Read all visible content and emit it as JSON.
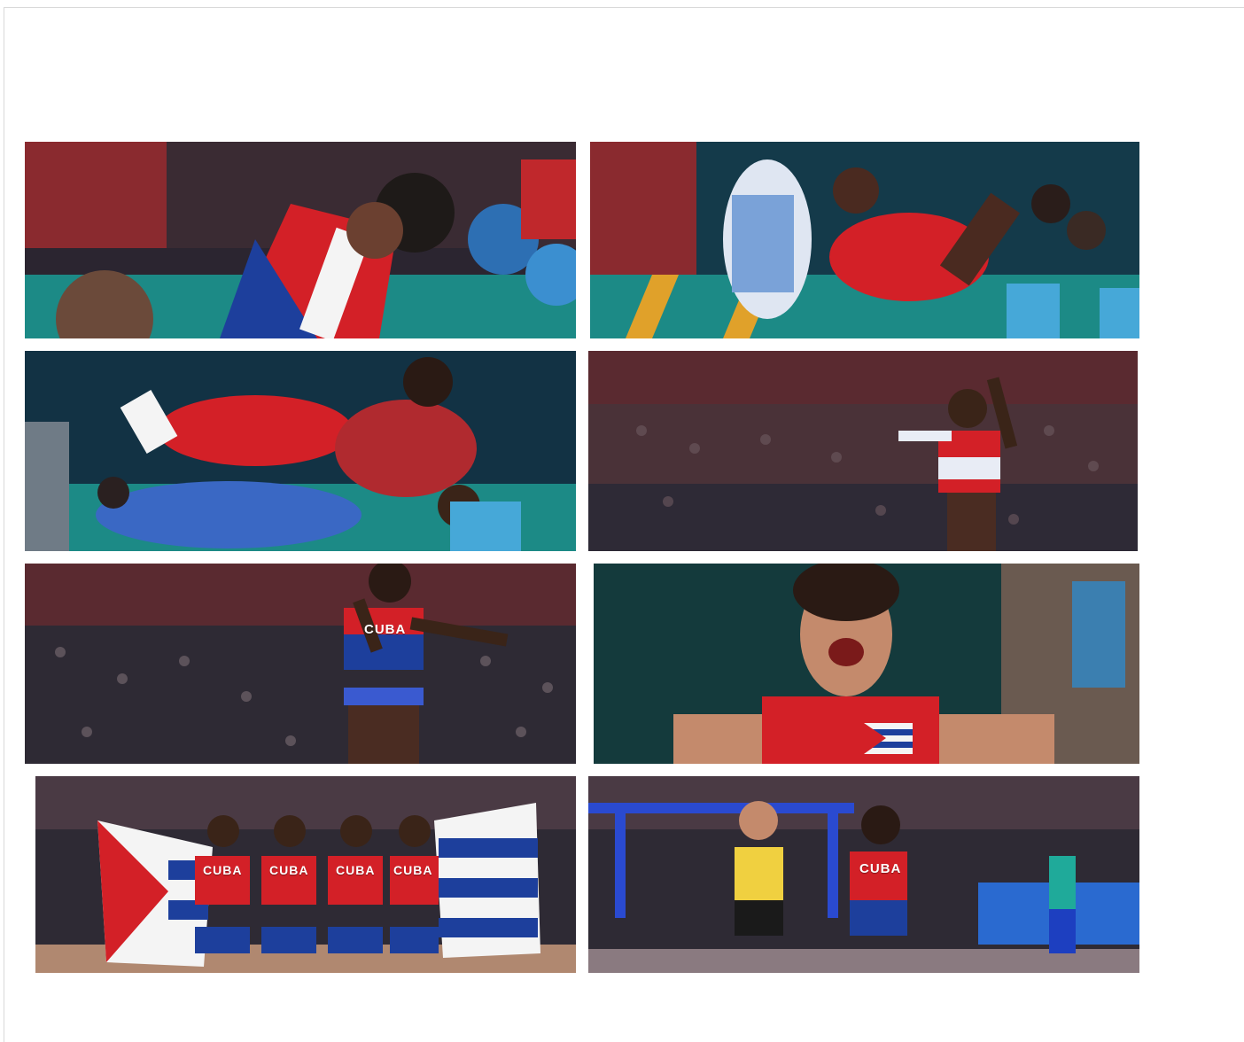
{
  "photos": [
    {
      "scene": "wrestler-celebration-with-flag"
    },
    {
      "scene": "wrestling-throw-usa"
    },
    {
      "scene": "wrestling-takedown"
    },
    {
      "scene": "triple-jump-athlete"
    },
    {
      "scene": "long-jump-athlete",
      "bib_text": "CUBA"
    },
    {
      "scene": "wrestler-shouting-with-flag"
    },
    {
      "scene": "relay-team-with-flags",
      "bib_text": "CUBA"
    },
    {
      "scene": "sprint-finish",
      "bib_text": "CUBA"
    }
  ],
  "colors": {
    "cuba_blue": "#1d3f9c",
    "cuba_red": "#d32027",
    "arena_teal": "#1c8a86",
    "stadium_red": "#8a2a2f",
    "crowd_dark": "#2b2530"
  }
}
